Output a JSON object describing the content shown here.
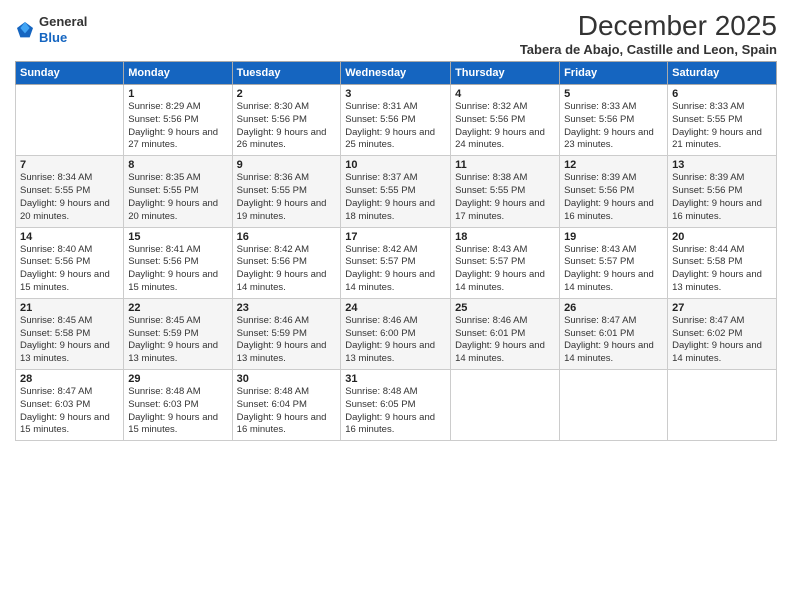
{
  "logo": {
    "general": "General",
    "blue": "Blue"
  },
  "title": "December 2025",
  "subtitle": "Tabera de Abajo, Castille and Leon, Spain",
  "headers": [
    "Sunday",
    "Monday",
    "Tuesday",
    "Wednesday",
    "Thursday",
    "Friday",
    "Saturday"
  ],
  "weeks": [
    [
      {
        "day": "",
        "sunrise": "",
        "sunset": "",
        "daylight": ""
      },
      {
        "day": "1",
        "sunrise": "Sunrise: 8:29 AM",
        "sunset": "Sunset: 5:56 PM",
        "daylight": "Daylight: 9 hours and 27 minutes."
      },
      {
        "day": "2",
        "sunrise": "Sunrise: 8:30 AM",
        "sunset": "Sunset: 5:56 PM",
        "daylight": "Daylight: 9 hours and 26 minutes."
      },
      {
        "day": "3",
        "sunrise": "Sunrise: 8:31 AM",
        "sunset": "Sunset: 5:56 PM",
        "daylight": "Daylight: 9 hours and 25 minutes."
      },
      {
        "day": "4",
        "sunrise": "Sunrise: 8:32 AM",
        "sunset": "Sunset: 5:56 PM",
        "daylight": "Daylight: 9 hours and 24 minutes."
      },
      {
        "day": "5",
        "sunrise": "Sunrise: 8:33 AM",
        "sunset": "Sunset: 5:56 PM",
        "daylight": "Daylight: 9 hours and 23 minutes."
      },
      {
        "day": "6",
        "sunrise": "Sunrise: 8:33 AM",
        "sunset": "Sunset: 5:55 PM",
        "daylight": "Daylight: 9 hours and 21 minutes."
      }
    ],
    [
      {
        "day": "7",
        "sunrise": "Sunrise: 8:34 AM",
        "sunset": "Sunset: 5:55 PM",
        "daylight": "Daylight: 9 hours and 20 minutes."
      },
      {
        "day": "8",
        "sunrise": "Sunrise: 8:35 AM",
        "sunset": "Sunset: 5:55 PM",
        "daylight": "Daylight: 9 hours and 20 minutes."
      },
      {
        "day": "9",
        "sunrise": "Sunrise: 8:36 AM",
        "sunset": "Sunset: 5:55 PM",
        "daylight": "Daylight: 9 hours and 19 minutes."
      },
      {
        "day": "10",
        "sunrise": "Sunrise: 8:37 AM",
        "sunset": "Sunset: 5:55 PM",
        "daylight": "Daylight: 9 hours and 18 minutes."
      },
      {
        "day": "11",
        "sunrise": "Sunrise: 8:38 AM",
        "sunset": "Sunset: 5:55 PM",
        "daylight": "Daylight: 9 hours and 17 minutes."
      },
      {
        "day": "12",
        "sunrise": "Sunrise: 8:39 AM",
        "sunset": "Sunset: 5:56 PM",
        "daylight": "Daylight: 9 hours and 16 minutes."
      },
      {
        "day": "13",
        "sunrise": "Sunrise: 8:39 AM",
        "sunset": "Sunset: 5:56 PM",
        "daylight": "Daylight: 9 hours and 16 minutes."
      }
    ],
    [
      {
        "day": "14",
        "sunrise": "Sunrise: 8:40 AM",
        "sunset": "Sunset: 5:56 PM",
        "daylight": "Daylight: 9 hours and 15 minutes."
      },
      {
        "day": "15",
        "sunrise": "Sunrise: 8:41 AM",
        "sunset": "Sunset: 5:56 PM",
        "daylight": "Daylight: 9 hours and 15 minutes."
      },
      {
        "day": "16",
        "sunrise": "Sunrise: 8:42 AM",
        "sunset": "Sunset: 5:56 PM",
        "daylight": "Daylight: 9 hours and 14 minutes."
      },
      {
        "day": "17",
        "sunrise": "Sunrise: 8:42 AM",
        "sunset": "Sunset: 5:57 PM",
        "daylight": "Daylight: 9 hours and 14 minutes."
      },
      {
        "day": "18",
        "sunrise": "Sunrise: 8:43 AM",
        "sunset": "Sunset: 5:57 PM",
        "daylight": "Daylight: 9 hours and 14 minutes."
      },
      {
        "day": "19",
        "sunrise": "Sunrise: 8:43 AM",
        "sunset": "Sunset: 5:57 PM",
        "daylight": "Daylight: 9 hours and 14 minutes."
      },
      {
        "day": "20",
        "sunrise": "Sunrise: 8:44 AM",
        "sunset": "Sunset: 5:58 PM",
        "daylight": "Daylight: 9 hours and 13 minutes."
      }
    ],
    [
      {
        "day": "21",
        "sunrise": "Sunrise: 8:45 AM",
        "sunset": "Sunset: 5:58 PM",
        "daylight": "Daylight: 9 hours and 13 minutes."
      },
      {
        "day": "22",
        "sunrise": "Sunrise: 8:45 AM",
        "sunset": "Sunset: 5:59 PM",
        "daylight": "Daylight: 9 hours and 13 minutes."
      },
      {
        "day": "23",
        "sunrise": "Sunrise: 8:46 AM",
        "sunset": "Sunset: 5:59 PM",
        "daylight": "Daylight: 9 hours and 13 minutes."
      },
      {
        "day": "24",
        "sunrise": "Sunrise: 8:46 AM",
        "sunset": "Sunset: 6:00 PM",
        "daylight": "Daylight: 9 hours and 13 minutes."
      },
      {
        "day": "25",
        "sunrise": "Sunrise: 8:46 AM",
        "sunset": "Sunset: 6:01 PM",
        "daylight": "Daylight: 9 hours and 14 minutes."
      },
      {
        "day": "26",
        "sunrise": "Sunrise: 8:47 AM",
        "sunset": "Sunset: 6:01 PM",
        "daylight": "Daylight: 9 hours and 14 minutes."
      },
      {
        "day": "27",
        "sunrise": "Sunrise: 8:47 AM",
        "sunset": "Sunset: 6:02 PM",
        "daylight": "Daylight: 9 hours and 14 minutes."
      }
    ],
    [
      {
        "day": "28",
        "sunrise": "Sunrise: 8:47 AM",
        "sunset": "Sunset: 6:03 PM",
        "daylight": "Daylight: 9 hours and 15 minutes."
      },
      {
        "day": "29",
        "sunrise": "Sunrise: 8:48 AM",
        "sunset": "Sunset: 6:03 PM",
        "daylight": "Daylight: 9 hours and 15 minutes."
      },
      {
        "day": "30",
        "sunrise": "Sunrise: 8:48 AM",
        "sunset": "Sunset: 6:04 PM",
        "daylight": "Daylight: 9 hours and 16 minutes."
      },
      {
        "day": "31",
        "sunrise": "Sunrise: 8:48 AM",
        "sunset": "Sunset: 6:05 PM",
        "daylight": "Daylight: 9 hours and 16 minutes."
      },
      {
        "day": "",
        "sunrise": "",
        "sunset": "",
        "daylight": ""
      },
      {
        "day": "",
        "sunrise": "",
        "sunset": "",
        "daylight": ""
      },
      {
        "day": "",
        "sunrise": "",
        "sunset": "",
        "daylight": ""
      }
    ]
  ]
}
